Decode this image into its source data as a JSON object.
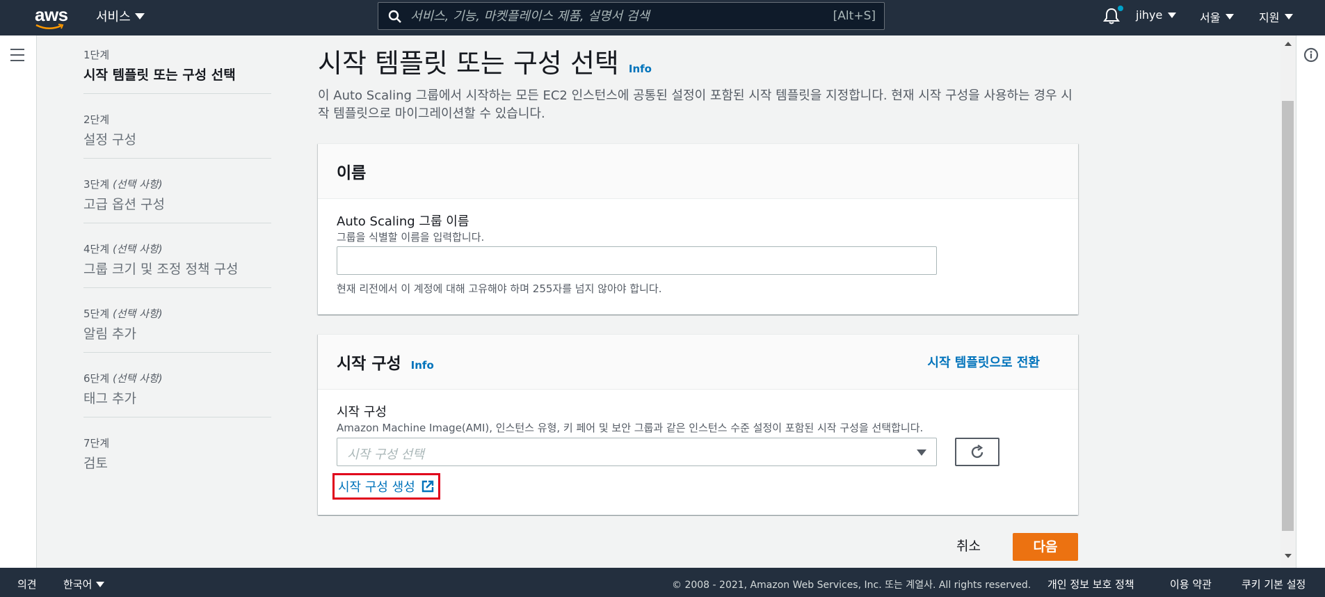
{
  "topnav": {
    "logo_text": "aws",
    "services_label": "서비스",
    "search_placeholder": "서비스, 기능, 마켓플레이스 제품, 설명서 검색",
    "search_shortcut": "[Alt+S]",
    "user_label": "jihye",
    "region_label": "서울",
    "support_label": "지원"
  },
  "steps": [
    {
      "num": "1단계",
      "optional": "",
      "title": "시작 템플릿 또는 구성 선택",
      "active": true
    },
    {
      "num": "2단계",
      "optional": "",
      "title": "설정 구성",
      "active": false
    },
    {
      "num": "3단계",
      "optional": "(선택 사항)",
      "title": "고급 옵션 구성",
      "active": false
    },
    {
      "num": "4단계",
      "optional": "(선택 사항)",
      "title": "그룹 크기 및 조정 정책 구성",
      "active": false
    },
    {
      "num": "5단계",
      "optional": "(선택 사항)",
      "title": "알림 추가",
      "active": false
    },
    {
      "num": "6단계",
      "optional": "(선택 사항)",
      "title": "태그 추가",
      "active": false
    },
    {
      "num": "7단계",
      "optional": "",
      "title": "검토",
      "active": false
    }
  ],
  "main": {
    "title": "시작 템플릿 또는 구성 선택",
    "info_label": "Info",
    "description": "이 Auto Scaling 그룹에서 시작하는 모든 EC2 인스턴스에 공통된 설정이 포함된 시작 템플릿을 지정합니다. 현재 시작 구성을 사용하는 경우 시작 템플릿으로 마이그레이션할 수 있습니다."
  },
  "name_card": {
    "title": "이름",
    "field_label": "Auto Scaling 그룹 이름",
    "field_desc": "그룹을 식별할 이름을 입력합니다.",
    "field_value": "",
    "field_hint": "현재 리전에서 이 계정에 대해 고유해야 하며 255자를 넘지 않아야 합니다."
  },
  "launch_card": {
    "title": "시작 구성",
    "info_label": "Info",
    "switch_label": "시작 템플릿으로 전환",
    "field_label": "시작 구성",
    "field_desc": "Amazon Machine Image(AMI), 인스턴스 유형, 키 페어 및 보안 그룹과 같은 인스턴스 수준 설정이 포함된 시작 구성을 선택합니다.",
    "select_placeholder": "시작 구성 선택",
    "create_link": "시작 구성 생성"
  },
  "actions": {
    "cancel_label": "취소",
    "next_label": "다음"
  },
  "footer": {
    "feedback_label": "의견",
    "language_label": "한국어",
    "copyright": "© 2008 - 2021, Amazon Web Services, Inc. 또는 계열사. All rights reserved.",
    "privacy_label": "개인 정보 보호 정책",
    "terms_label": "이용 약관",
    "cookie_label": "쿠키 기본 설정"
  },
  "colors": {
    "nav_bg": "#232f3e",
    "link": "#0073bb",
    "primary_button": "#ec7211",
    "highlight_border": "#e0001b"
  }
}
